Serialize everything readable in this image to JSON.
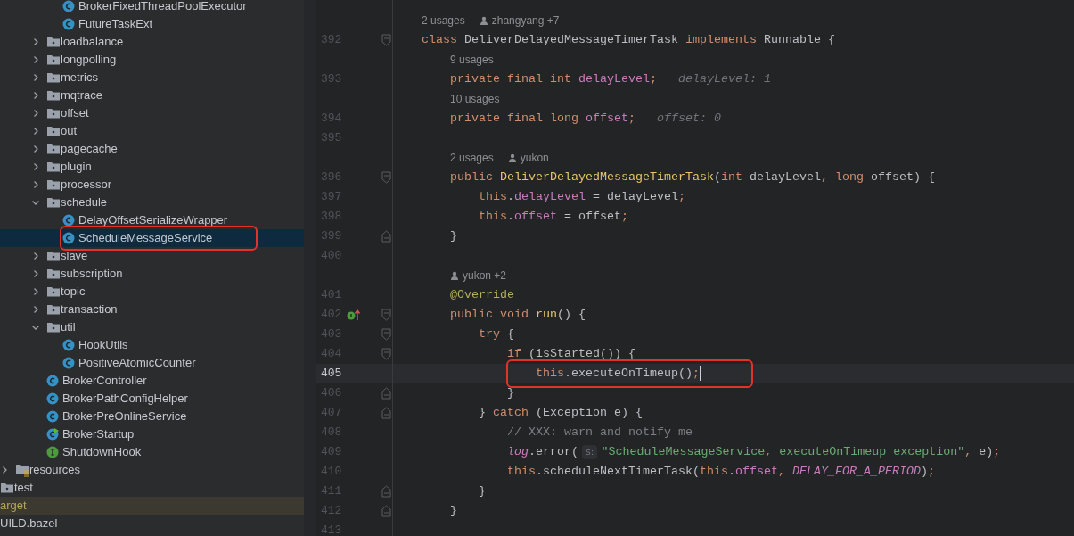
{
  "tree": [
    {
      "children": [
        {
          "children": [
            {
              "children": [
                {
                  "children": [
                    {
                      "children": [
                        {
                          "kind": "class",
                          "label": "BrokerFixedThreadPoolExecutor",
                          "selected": false,
                          "marked": false
                        },
                        {
                          "kind": "class",
                          "label": "FutureTaskExt",
                          "selected": false,
                          "marked": false
                        }
                      ]
                    },
                    {
                      "kind": "folder",
                      "label": "loadbalance",
                      "expanded": false,
                      "selected": false,
                      "marked": false
                    },
                    {
                      "kind": "folder",
                      "label": "longpolling",
                      "expanded": false,
                      "selected": false,
                      "marked": false
                    },
                    {
                      "kind": "folder",
                      "label": "metrics",
                      "expanded": false,
                      "selected": false,
                      "marked": false
                    },
                    {
                      "kind": "folder",
                      "label": "mqtrace",
                      "expanded": false,
                      "selected": false,
                      "marked": false
                    },
                    {
                      "kind": "folder",
                      "label": "offset",
                      "expanded": false,
                      "selected": false,
                      "marked": false
                    },
                    {
                      "kind": "folder",
                      "label": "out",
                      "expanded": false,
                      "selected": false,
                      "marked": false
                    },
                    {
                      "kind": "folder",
                      "label": "pagecache",
                      "expanded": false,
                      "selected": false,
                      "marked": false
                    },
                    {
                      "kind": "folder",
                      "label": "plugin",
                      "expanded": false,
                      "selected": false,
                      "marked": false
                    },
                    {
                      "kind": "folder",
                      "label": "processor",
                      "expanded": false,
                      "selected": false,
                      "marked": false
                    },
                    {
                      "kind": "folder",
                      "label": "schedule",
                      "expanded": true,
                      "selected": false,
                      "marked": false,
                      "children": [
                        {
                          "kind": "class",
                          "label": "DelayOffsetSerializeWrapper",
                          "selected": false,
                          "marked": false
                        },
                        {
                          "kind": "class",
                          "label": "ScheduleMessageService",
                          "selected": true,
                          "marked": true
                        }
                      ]
                    },
                    {
                      "kind": "folder",
                      "label": "slave",
                      "expanded": false,
                      "selected": false,
                      "marked": false
                    },
                    {
                      "kind": "folder",
                      "label": "subscription",
                      "expanded": false,
                      "selected": false,
                      "marked": false
                    },
                    {
                      "kind": "folder",
                      "label": "topic",
                      "expanded": false,
                      "selected": false,
                      "marked": false
                    },
                    {
                      "kind": "folder",
                      "label": "transaction",
                      "expanded": false,
                      "selected": false,
                      "marked": false
                    },
                    {
                      "kind": "folder",
                      "label": "util",
                      "expanded": true,
                      "selected": false,
                      "marked": false,
                      "children": [
                        {
                          "kind": "class",
                          "label": "HookUtils",
                          "selected": false,
                          "marked": false
                        },
                        {
                          "kind": "class",
                          "label": "PositiveAtomicCounter",
                          "selected": false,
                          "marked": false
                        }
                      ]
                    },
                    {
                      "kind": "class",
                      "label": "BrokerController",
                      "selected": false,
                      "marked": false
                    },
                    {
                      "kind": "class",
                      "label": "BrokerPathConfigHelper",
                      "selected": false,
                      "marked": false
                    },
                    {
                      "kind": "class",
                      "label": "BrokerPreOnlineService",
                      "selected": false,
                      "marked": false
                    },
                    {
                      "kind": "main-class",
                      "label": "BrokerStartup",
                      "selected": false,
                      "marked": false
                    },
                    {
                      "kind": "interface",
                      "label": "ShutdownHook",
                      "selected": false,
                      "marked": false
                    }
                  ]
                }
              ]
            },
            {
              "kind": "resources",
              "label": "resources",
              "expanded": false,
              "selected": false,
              "marked": false
            }
          ]
        },
        {
          "kind": "folder",
          "label": "test",
          "selected": false,
          "marked": false
        }
      ]
    },
    {
      "kind": "excluded",
      "label": "arget",
      "selected": false,
      "marked": false
    },
    {
      "kind": "file",
      "label": "UILD.bazel",
      "selected": false,
      "marked": false
    }
  ],
  "editor": {
    "lines": [
      {
        "kind": "inlay",
        "usages": "2 usages",
        "author": "zhangyang +7"
      },
      {
        "kind": "code",
        "number": "392",
        "fold_start": true,
        "tokens": [
          {
            "kind": "kw",
            "text": "    class"
          },
          {
            "kind": "plain",
            "text": " DeliverDelayedMessageTimerTask "
          },
          {
            "kind": "kw",
            "text": "implements"
          },
          {
            "kind": "plain",
            "text": " Runnable {"
          }
        ]
      },
      {
        "kind": "inlay",
        "usages": "9 usages"
      },
      {
        "kind": "code",
        "number": "393",
        "tokens": [
          {
            "kind": "kw",
            "text": "        private final int"
          },
          {
            "kind": "field",
            "text": " delayLevel"
          },
          {
            "kind": "kw",
            "text": ";"
          },
          {
            "kind": "hint",
            "text": "delayLevel: 1"
          }
        ]
      },
      {
        "kind": "inlay",
        "usages": "10 usages"
      },
      {
        "kind": "code",
        "number": "394",
        "tokens": [
          {
            "kind": "kw",
            "text": "        private final long"
          },
          {
            "kind": "field",
            "text": " offset"
          },
          {
            "kind": "kw",
            "text": ";"
          },
          {
            "kind": "hint",
            "text": "offset: 0"
          }
        ]
      },
      {
        "kind": "code",
        "number": "395"
      },
      {
        "kind": "inlay",
        "usages": "2 usages",
        "author": "yukon"
      },
      {
        "kind": "code",
        "number": "396",
        "fold_start": true,
        "tokens": [
          {
            "kind": "kw",
            "text": "        public"
          },
          {
            "kind": "decl",
            "text": " DeliverDelayedMessageTimerTask"
          },
          {
            "kind": "plain",
            "text": "("
          },
          {
            "kind": "kw",
            "text": "int"
          },
          {
            "kind": "plain",
            "text": " delayLevel"
          },
          {
            "kind": "kw",
            "text": ", long"
          },
          {
            "kind": "plain",
            "text": " offset) {"
          }
        ]
      },
      {
        "kind": "code",
        "number": "397",
        "tokens": [
          {
            "kind": "kw",
            "text": "            this"
          },
          {
            "kind": "plain",
            "text": "."
          },
          {
            "kind": "field",
            "text": "delayLevel"
          },
          {
            "kind": "plain",
            "text": " = delayLevel"
          },
          {
            "kind": "kw",
            "text": ";"
          }
        ]
      },
      {
        "kind": "code",
        "number": "398",
        "tokens": [
          {
            "kind": "kw",
            "text": "            this"
          },
          {
            "kind": "plain",
            "text": "."
          },
          {
            "kind": "field",
            "text": "offset"
          },
          {
            "kind": "plain",
            "text": " = offset"
          },
          {
            "kind": "kw",
            "text": ";"
          }
        ]
      },
      {
        "kind": "code",
        "number": "399",
        "fold_end": true,
        "tokens": [
          {
            "kind": "plain",
            "text": "        }"
          }
        ]
      },
      {
        "kind": "code",
        "number": "400"
      },
      {
        "kind": "inlay",
        "author": "yukon +2"
      },
      {
        "kind": "code",
        "number": "401",
        "tokens": [
          {
            "kind": "annotation",
            "text": "        @Override"
          }
        ]
      },
      {
        "kind": "code",
        "number": "402",
        "fold_start": true,
        "override": true,
        "tokens": [
          {
            "kind": "kw",
            "text": "        public void"
          },
          {
            "kind": "decl",
            "text": " run"
          },
          {
            "kind": "plain",
            "text": "() {"
          }
        ]
      },
      {
        "kind": "code",
        "number": "403",
        "fold_start": true,
        "tokens": [
          {
            "kind": "kw",
            "text": "            try"
          },
          {
            "kind": "plain",
            "text": " {"
          }
        ]
      },
      {
        "kind": "code",
        "number": "404",
        "fold_start": true,
        "tokens": [
          {
            "kind": "kw",
            "text": "                if"
          },
          {
            "kind": "plain",
            "text": " (isStarted()) {"
          }
        ]
      },
      {
        "kind": "code",
        "number": "405",
        "current": true,
        "marked": true,
        "tokens": [
          {
            "kind": "kw",
            "text": "                    this"
          },
          {
            "kind": "plain",
            "text": ".executeOnTimeup()"
          },
          {
            "kind": "kw",
            "text": ";"
          }
        ]
      },
      {
        "kind": "code",
        "number": "406",
        "fold_end": true,
        "tokens": [
          {
            "kind": "plain",
            "text": "                }"
          }
        ]
      },
      {
        "kind": "code",
        "number": "407",
        "fold_end": true,
        "tokens": [
          {
            "kind": "plain",
            "text": "            } "
          },
          {
            "kind": "kw",
            "text": "catch"
          },
          {
            "kind": "plain",
            "text": " (Exception e) {"
          }
        ]
      },
      {
        "kind": "code",
        "number": "408",
        "tokens": [
          {
            "kind": "comment",
            "text": "                // XXX: warn and notify me"
          }
        ]
      },
      {
        "kind": "code",
        "number": "409",
        "tokens": [
          {
            "kind": "static",
            "text": "                log"
          },
          {
            "kind": "plain",
            "text": ".error("
          },
          {
            "kind": "param",
            "text": "s:"
          },
          {
            "kind": "string",
            "text": "\"ScheduleMessageService, executeOnTimeup exception\""
          },
          {
            "kind": "kw",
            "text": ","
          },
          {
            "kind": "plain",
            "text": " e)"
          },
          {
            "kind": "kw",
            "text": ";"
          }
        ]
      },
      {
        "kind": "code",
        "number": "410",
        "tokens": [
          {
            "kind": "kw",
            "text": "                this"
          },
          {
            "kind": "plain",
            "text": ".scheduleNextTimerTask("
          },
          {
            "kind": "kw",
            "text": "this"
          },
          {
            "kind": "plain",
            "text": "."
          },
          {
            "kind": "field",
            "text": "offset"
          },
          {
            "kind": "kw",
            "text": ","
          },
          {
            "kind": "static",
            "text": " DELAY_FOR_A_PERIOD"
          },
          {
            "kind": "plain",
            "text": ")"
          },
          {
            "kind": "kw",
            "text": ";"
          }
        ]
      },
      {
        "kind": "code",
        "number": "411",
        "fold_end": true,
        "tokens": [
          {
            "kind": "plain",
            "text": "            }"
          }
        ]
      },
      {
        "kind": "code",
        "number": "412",
        "fold_end": true,
        "tokens": [
          {
            "kind": "plain",
            "text": "        }"
          }
        ]
      },
      {
        "kind": "code",
        "number": "413"
      }
    ]
  }
}
